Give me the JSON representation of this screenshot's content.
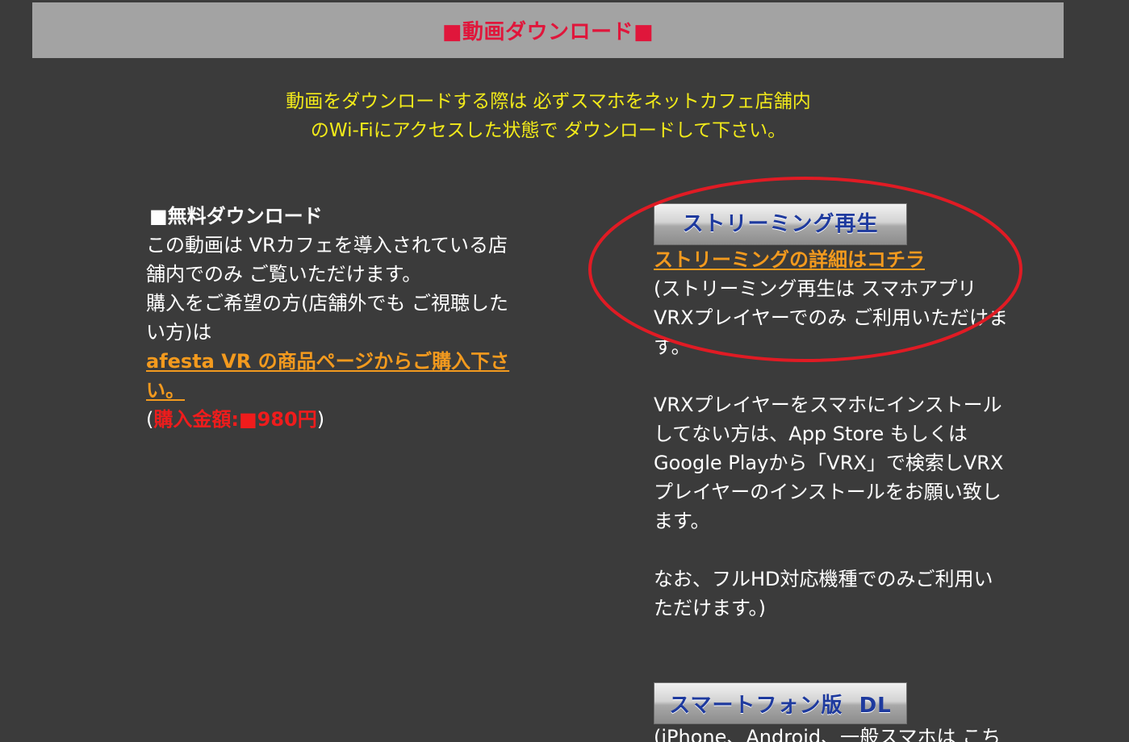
{
  "header": {
    "title": "■動画ダウンロード■"
  },
  "notice": {
    "line1": "動画をダウンロードする際は 必ずスマホをネットカフェ店舗内",
    "line2": "のWi-Fiにアクセスした状態で ダウンロードして下さい。"
  },
  "free_download": {
    "heading": "■無料ダウンロード",
    "body": "この動画は VRカフェを導入されている店舗内でのみ ご覧いただけます。",
    "purchase_text": "購入をご希望の方(店舗外でも ご視聴したい方)は",
    "purchase_link": "afesta VR の商品ページからご購入下さい。",
    "price_open": "(",
    "price_label": "購入金額:■980円",
    "price_close": ")"
  },
  "streaming": {
    "button_label": "ストリーミング再生",
    "details_link": "ストリーミングの詳細はコチラ",
    "para1": "(ストリーミング再生は スマホアプリVRXプレイヤーでのみ ご利用いただけます。",
    "para2": "VRXプレイヤーをスマホにインストールしてない方は、App Store もしくはGoogle Playから「VRX」で検索しVRXプレイヤーのインストールをお願い致します。",
    "para3": "なお、フルHD対応機種でのみご利用いただけます。)"
  },
  "smartphone": {
    "button_label": "スマートフォン版  DL",
    "text": "(iPhone、Android、一般スマホは こち"
  },
  "colors": {
    "background": "#3b3b3b",
    "header_bar": "#a3a3a3",
    "header_text": "#e0163b",
    "notice_text": "#f2ea1a",
    "link": "#f39a1e",
    "price": "#ef1c1c",
    "button_text": "#1e3a9e",
    "annotation": "#e01b24"
  }
}
